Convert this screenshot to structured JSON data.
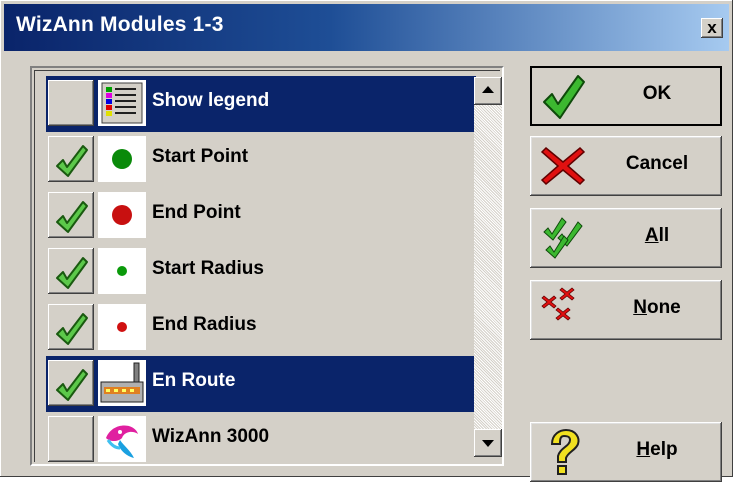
{
  "window": {
    "title": "WizAnn Modules 1-3",
    "close_label": "x"
  },
  "list": {
    "items": [
      {
        "label": "Show legend",
        "checked": false,
        "selected": true,
        "icon": "legend-icon"
      },
      {
        "label": "Start Point",
        "checked": true,
        "selected": false,
        "icon": "green-large-dot-icon"
      },
      {
        "label": "End Point",
        "checked": true,
        "selected": false,
        "icon": "red-large-dot-icon"
      },
      {
        "label": "Start Radius",
        "checked": true,
        "selected": false,
        "icon": "green-small-dot-icon"
      },
      {
        "label": "End Radius",
        "checked": true,
        "selected": false,
        "icon": "red-small-dot-icon"
      },
      {
        "label": "En Route",
        "checked": true,
        "selected": true,
        "icon": "factory-icon"
      },
      {
        "label": "WizAnn 3000",
        "checked": false,
        "selected": false,
        "icon": "wizann-logo-icon"
      }
    ]
  },
  "buttons": {
    "ok": "OK",
    "cancel": "Cancel",
    "all": "All",
    "none": "None",
    "help": "Help"
  },
  "colors": {
    "selection": "#0a246a",
    "face": "#d4d0c8",
    "check_green": "#2e9a1e",
    "cross_red": "#e01010"
  }
}
